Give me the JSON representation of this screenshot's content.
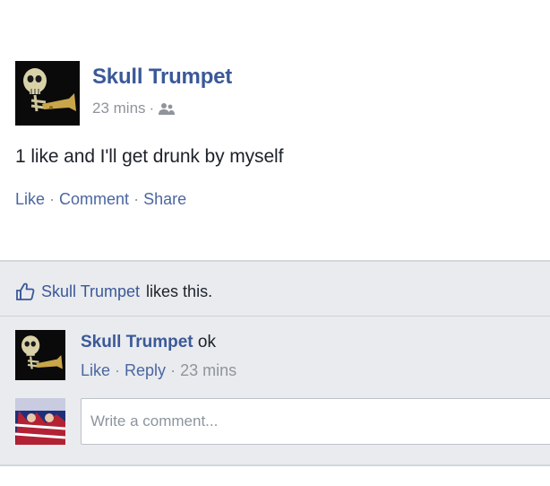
{
  "post": {
    "author": "Skull Trumpet",
    "time": "23 mins",
    "separator": "·",
    "audience_icon": "friends-icon",
    "text": "1 like and I'll get drunk by myself",
    "actions": {
      "like": "Like",
      "comment": "Comment",
      "share": "Share"
    }
  },
  "feedback": {
    "like_icon": "thumbs-up-icon",
    "likes_name": "Skull Trumpet",
    "likes_suffix": "likes this.",
    "comment": {
      "author": "Skull Trumpet",
      "text": "ok",
      "like": "Like",
      "reply": "Reply",
      "time": "23 mins"
    },
    "composer": {
      "placeholder": "Write a comment..."
    }
  },
  "colors": {
    "link": "#3b5998",
    "action": "#4b67a1",
    "muted": "#90949c",
    "feedback_bg": "#e9ebee"
  }
}
